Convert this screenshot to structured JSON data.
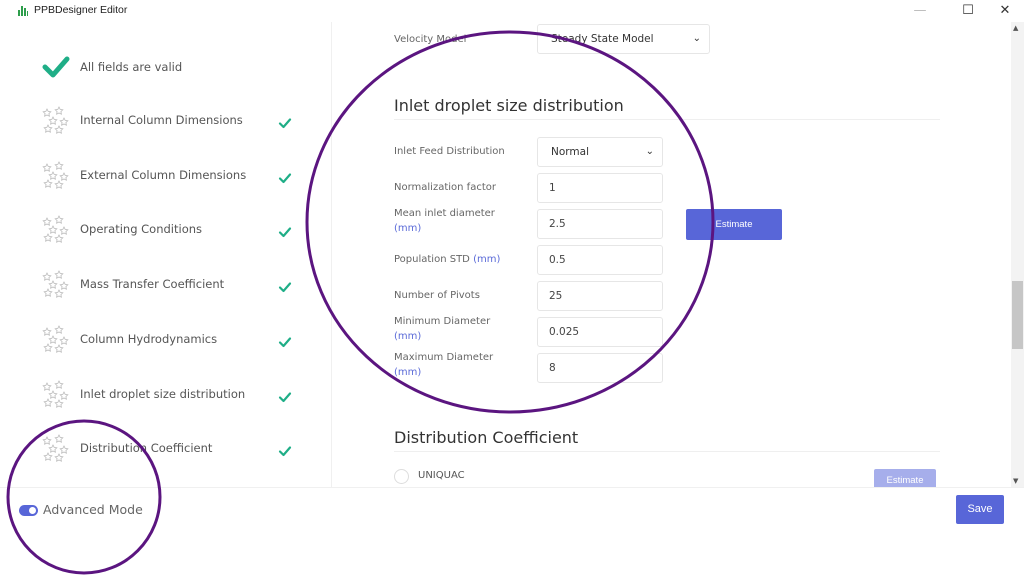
{
  "window": {
    "title": "PPBDesigner Editor",
    "controls": [
      "minimize",
      "maximize",
      "close"
    ]
  },
  "sidebar": {
    "status": "All fields are valid",
    "items": [
      {
        "label": "Internal Column Dimensions",
        "valid": true
      },
      {
        "label": "External Column Dimensions",
        "valid": true
      },
      {
        "label": "Operating Conditions",
        "valid": true
      },
      {
        "label": "Mass Transfer Coefficient",
        "valid": true
      },
      {
        "label": "Column Hydrodynamics",
        "valid": true
      },
      {
        "label": "Inlet droplet size distribution",
        "valid": true
      },
      {
        "label": "Distribution Coefficient",
        "valid": true
      }
    ]
  },
  "main": {
    "velocity_model": {
      "label": "Velocity Model",
      "value": "Steady State Model"
    },
    "inlet_section": {
      "title": "Inlet droplet size distribution",
      "fields": [
        {
          "label": "Inlet Feed Distribution",
          "unit": "",
          "value": "Normal",
          "type": "select"
        },
        {
          "label": "Normalization factor",
          "unit": "",
          "value": "1",
          "type": "input"
        },
        {
          "label": "Mean inlet diameter",
          "unit": "(mm)",
          "value": "2.5",
          "type": "input"
        },
        {
          "label": "Population STD",
          "unit": "(mm)",
          "value": "0.5",
          "type": "input"
        },
        {
          "label": "Number of Pivots",
          "unit": "",
          "value": "25",
          "type": "input"
        },
        {
          "label": "Minimum Diameter",
          "unit": "(mm)",
          "value": "0.025",
          "type": "input"
        },
        {
          "label": "Maximum Diameter",
          "unit": "(mm)",
          "value": "8",
          "type": "input"
        }
      ],
      "estimate_label": "Estimate"
    },
    "distribution_section": {
      "title": "Distribution Coefficient",
      "option": "UNIQUAC",
      "estimate_label": "Estimate"
    }
  },
  "footer": {
    "advanced_mode_label": "Advanced Mode",
    "advanced_mode_on": true,
    "save_label": "Save"
  },
  "colors": {
    "accent": "#5866d8",
    "valid": "#1fae87",
    "annotation": "#5b1580"
  }
}
